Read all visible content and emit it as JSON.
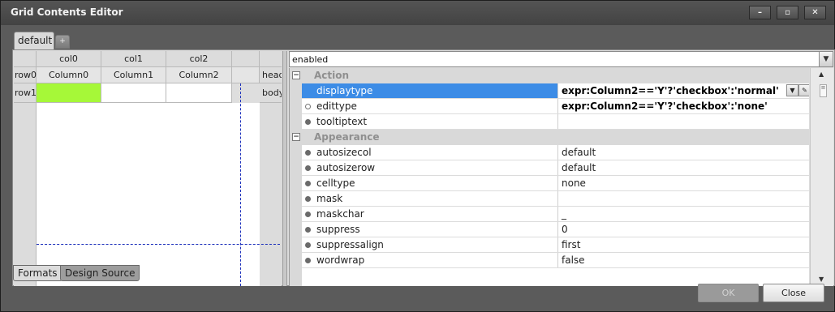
{
  "window": {
    "title": "Grid Contents Editor",
    "minimize_icon": "minimize-icon",
    "maximize_icon": "maximize-icon",
    "close_icon": "close-icon"
  },
  "format_tabs": {
    "items": [
      "default"
    ],
    "add_label": "+"
  },
  "grid_designer": {
    "columns": [
      "col0",
      "col1",
      "col2"
    ],
    "row_labels": [
      "row0",
      "row1"
    ],
    "band_labels": [
      "head",
      "body"
    ],
    "cells": [
      [
        "Column0",
        "Column1",
        "Column2"
      ],
      [
        "",
        "",
        ""
      ]
    ],
    "selected_cell_color": "#a6f838"
  },
  "property_combo": {
    "value": "enabled",
    "dropdown_icon": "chevron-down-icon"
  },
  "properties": {
    "categories": [
      {
        "name": "Action",
        "toggle": "⊟",
        "items": [
          {
            "name": "displaytype",
            "value": "expr:Column2=='Y'?'checkbox':'normal'",
            "selected": true
          },
          {
            "name": "edittype",
            "value": "expr:Column2=='Y'?'checkbox':'none'",
            "selected": false
          },
          {
            "name": "tooltiptext",
            "value": "",
            "selected": false
          }
        ]
      },
      {
        "name": "Appearance",
        "toggle": "⊟",
        "items": [
          {
            "name": "autosizecol",
            "value": "default"
          },
          {
            "name": "autosizerow",
            "value": "default"
          },
          {
            "name": "celltype",
            "value": "none"
          },
          {
            "name": "mask",
            "value": ""
          },
          {
            "name": "maskchar",
            "value": "_"
          },
          {
            "name": "suppress",
            "value": "0"
          },
          {
            "name": "suppressalign",
            "value": "first"
          },
          {
            "name": "wordwrap",
            "value": "false"
          }
        ]
      }
    ],
    "selection_color": "#3c8ce6"
  },
  "bottom_tabs": [
    "Formats",
    "Design Source"
  ],
  "buttons": {
    "ok": "OK",
    "close": "Close"
  }
}
